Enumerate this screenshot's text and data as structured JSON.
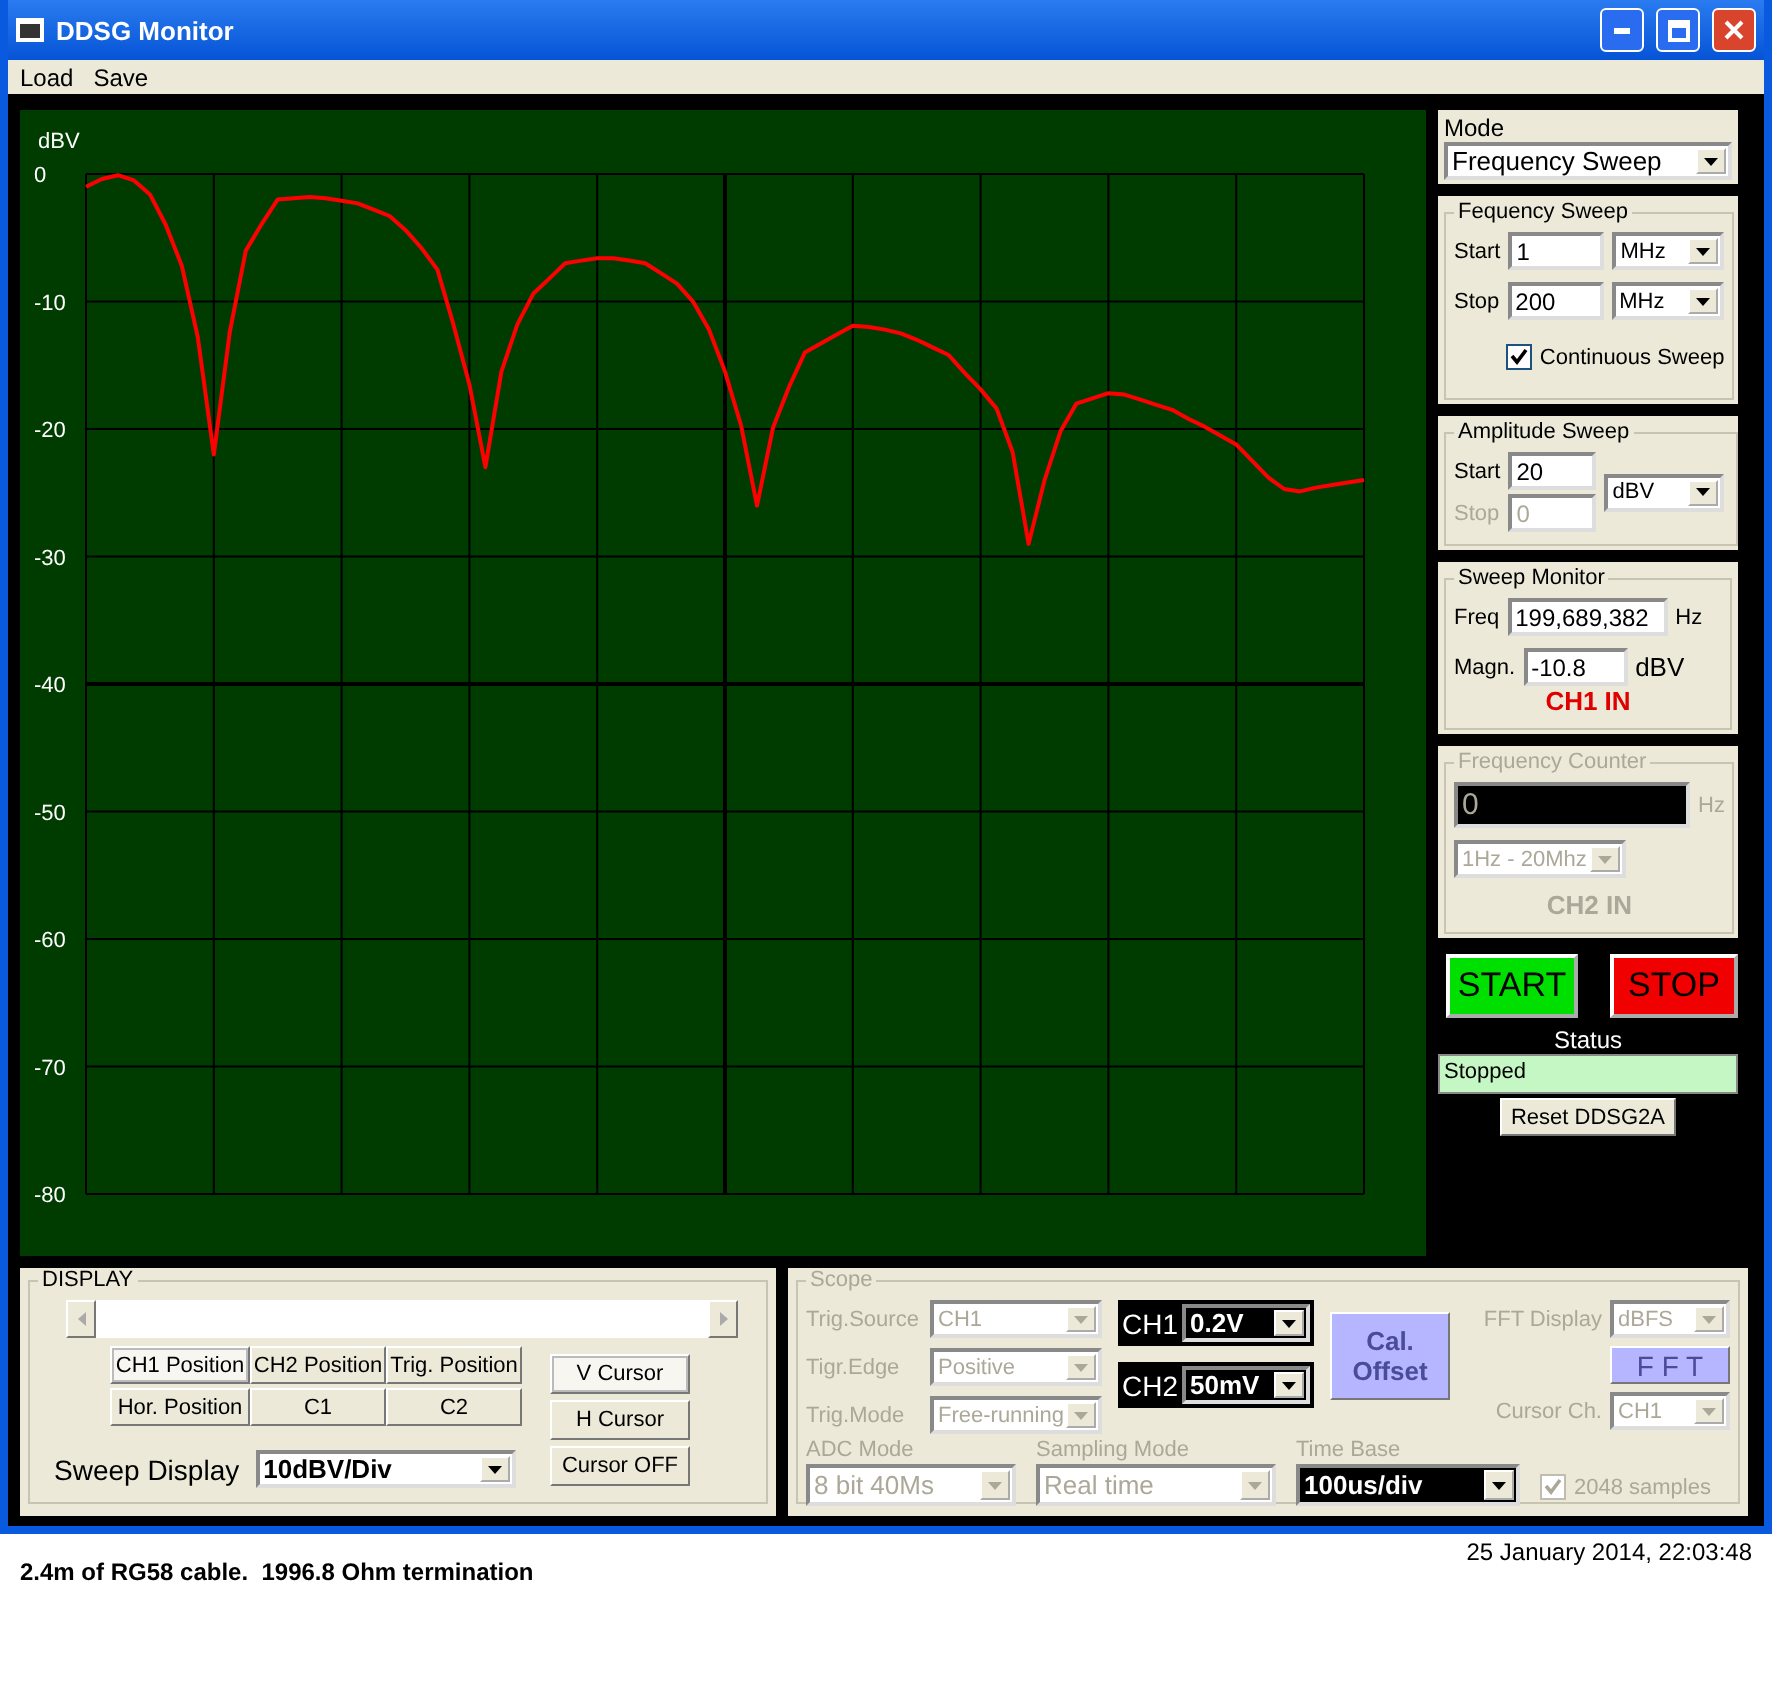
{
  "window": {
    "title": "DDSG Monitor"
  },
  "menu": [
    {
      "label": "Load"
    },
    {
      "label": "Save"
    }
  ],
  "plot": {
    "chart_data": {
      "type": "line",
      "ylabel": "dBV",
      "ylim": [
        -80,
        0
      ],
      "grid": true,
      "yticks": [
        0,
        -10,
        -20,
        -30,
        -40,
        -50,
        -60,
        -70,
        -80
      ],
      "categories": [
        null,
        null,
        null,
        null,
        null,
        null,
        null,
        null,
        null,
        null,
        null,
        null,
        null,
        null,
        null,
        null,
        null,
        null,
        null,
        null,
        null,
        null,
        null,
        null,
        null,
        null,
        null,
        null,
        null,
        null,
        null,
        null,
        null,
        null,
        null,
        null,
        null,
        null,
        null,
        null,
        null,
        null,
        null,
        null,
        null,
        null,
        null,
        null,
        null,
        null,
        null,
        null,
        null,
        null,
        null,
        null,
        null,
        null,
        null,
        null,
        null,
        null,
        null,
        null,
        null,
        null,
        null,
        null,
        null,
        null,
        null,
        null,
        null,
        null,
        null,
        null,
        null,
        null,
        null,
        null,
        null
      ],
      "series": [
        {
          "color": "#ff0000",
          "values": [
            -1,
            -0.4,
            -0.1,
            -0.5,
            -1.6,
            -4,
            -7.2,
            -12.8,
            -22,
            -12.4,
            -6,
            -3.9,
            -2,
            -1.9,
            -1.8,
            -1.9,
            -2.1,
            -2.3,
            -2.8,
            -3.3,
            -4.4,
            -5.8,
            -7.5,
            -11.8,
            -16.5,
            -23,
            -15.5,
            -11.8,
            -9.4,
            -8.2,
            -7,
            -6.8,
            -6.6,
            -6.6,
            -6.8,
            -7,
            -7.8,
            -8.6,
            -10,
            -12.2,
            -15.5,
            -19.7,
            -26,
            -19.9,
            -16.7,
            -14,
            -13.3,
            -12.6,
            -11.9,
            -12,
            -12.2,
            -12.5,
            -13,
            -13.6,
            -14.2,
            -15.6,
            -16.9,
            -18.4,
            -21.8,
            -29,
            -24,
            -20.2,
            -18,
            -17.6,
            -17.2,
            -17.3,
            -17.7,
            -18.1,
            -18.5,
            -19.2,
            -19.8,
            -20.5,
            -21.2,
            -22.5,
            -23.8,
            -24.7,
            -24.9,
            -24.6,
            -24.4,
            -24.2,
            -24
          ]
        }
      ]
    }
  },
  "mode": {
    "label": "Mode",
    "value": "Frequency Sweep"
  },
  "frequency_sweep": {
    "title": "Fequency Sweep",
    "start_label": "Start",
    "start_value": "1",
    "start_unit": "MHz",
    "stop_label": "Stop",
    "stop_value": "200",
    "stop_unit": "MHz",
    "continuous": {
      "label": "Continuous Sweep",
      "checked": true
    }
  },
  "amplitude_sweep": {
    "title": "Amplitude Sweep",
    "start_label": "Start",
    "start_value": "20",
    "stop_label": "Stop",
    "stop_value": "0",
    "stop_disabled": true,
    "unit": "dBV"
  },
  "sweep_monitor": {
    "title": "Sweep Monitor",
    "freq_label": "Freq",
    "freq_value": "199,689,382",
    "freq_unit": "Hz",
    "magn_label": "Magn.",
    "magn_value": "-10.8",
    "magn_unit": "dBV",
    "channel": "CH1 IN"
  },
  "frequency_counter": {
    "title": "Frequency Counter",
    "disabled": true,
    "value": "0",
    "unit": "Hz",
    "range": "1Hz - 20Mhz",
    "channel": "CH2 IN"
  },
  "start_button": "START",
  "stop_button": "STOP",
  "status": {
    "label": "Status",
    "value": "Stopped"
  },
  "reset_button": "Reset DDSG2A",
  "display": {
    "title": "DISPLAY",
    "position_buttons": [
      {
        "label": "CH1 Position",
        "selected": true
      },
      {
        "label": "CH2 Position",
        "selected": false
      },
      {
        "label": "Trig. Position",
        "selected": false
      },
      {
        "label": "Hor. Position",
        "selected": false
      },
      {
        "label": "C1",
        "selected": false
      },
      {
        "label": "C2",
        "selected": false
      }
    ],
    "cursor_buttons": [
      {
        "label": "V Cursor",
        "selected": true
      },
      {
        "label": "H Cursor",
        "selected": false
      },
      {
        "label": "Cursor OFF",
        "selected": false
      }
    ],
    "sweep_display": {
      "label": "Sweep Display",
      "value": "10dBV/Div"
    }
  },
  "scope": {
    "title": "Scope",
    "disabled": true,
    "trigger": [
      {
        "label": "Trig.Source",
        "value": "CH1"
      },
      {
        "label": "Tigr.Edge",
        "value": "Positive"
      },
      {
        "label": "Trig.Mode",
        "value": "Free-running"
      }
    ],
    "channels": [
      {
        "label": "CH1",
        "value": "0.2V"
      },
      {
        "label": "CH2",
        "value": "50mV"
      }
    ],
    "cal_button": "Cal. Offset",
    "fft_display": {
      "label": "FFT Display",
      "value": "dBFS"
    },
    "fft_button": "F F T",
    "cursor_ch": {
      "label": "Cursor Ch.",
      "value": "CH1"
    },
    "adc_mode": {
      "label": "ADC Mode",
      "value": "8 bit 40Ms"
    },
    "sampling_mode": {
      "label": "Sampling Mode",
      "value": "Real time"
    },
    "time_base": {
      "label": "Time Base",
      "value": "100us/div"
    },
    "samples": {
      "label": "2048 samples",
      "checked": true
    }
  },
  "footer": {
    "caption": "2.4m of RG58 cable.  1996.8 Ohm termination",
    "timestamp": "25 January 2014, 22:03:48"
  }
}
